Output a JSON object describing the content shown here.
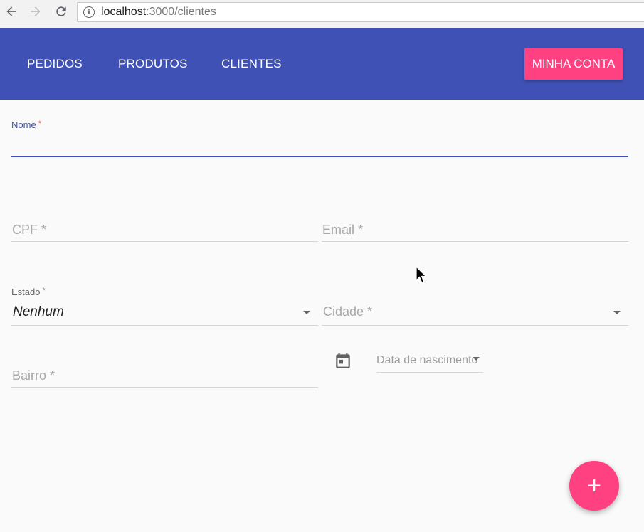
{
  "browser": {
    "url_host": "localhost",
    "url_path": ":3000/clientes",
    "info_symbol": "i"
  },
  "nav": {
    "items": [
      {
        "label": "PEDIDOS"
      },
      {
        "label": "PRODUTOS"
      },
      {
        "label": "CLIENTES"
      }
    ],
    "account_button": "MINHA CONTA"
  },
  "form": {
    "nome": {
      "label": "Nome",
      "required_mark": "*"
    },
    "cpf": {
      "placeholder": "CPF *"
    },
    "email": {
      "placeholder": "Email *"
    },
    "estado": {
      "label": "Estado",
      "required_mark": "*",
      "value": "Nenhum"
    },
    "cidade": {
      "placeholder": "Cidade *"
    },
    "bairro": {
      "placeholder": "Bairro *"
    },
    "data_nascimento": {
      "placeholder": "Data de nascimento"
    }
  },
  "fab": {
    "symbol": "+"
  },
  "colors": {
    "primary": "#3f51b5",
    "accent": "#ff4081",
    "error": "#f44336"
  },
  "icons": [
    "back-arrow-icon",
    "forward-arrow-icon",
    "reload-icon",
    "info-icon",
    "chevron-down-icon",
    "calendar-icon",
    "plus-icon",
    "mouse-pointer-icon"
  ]
}
